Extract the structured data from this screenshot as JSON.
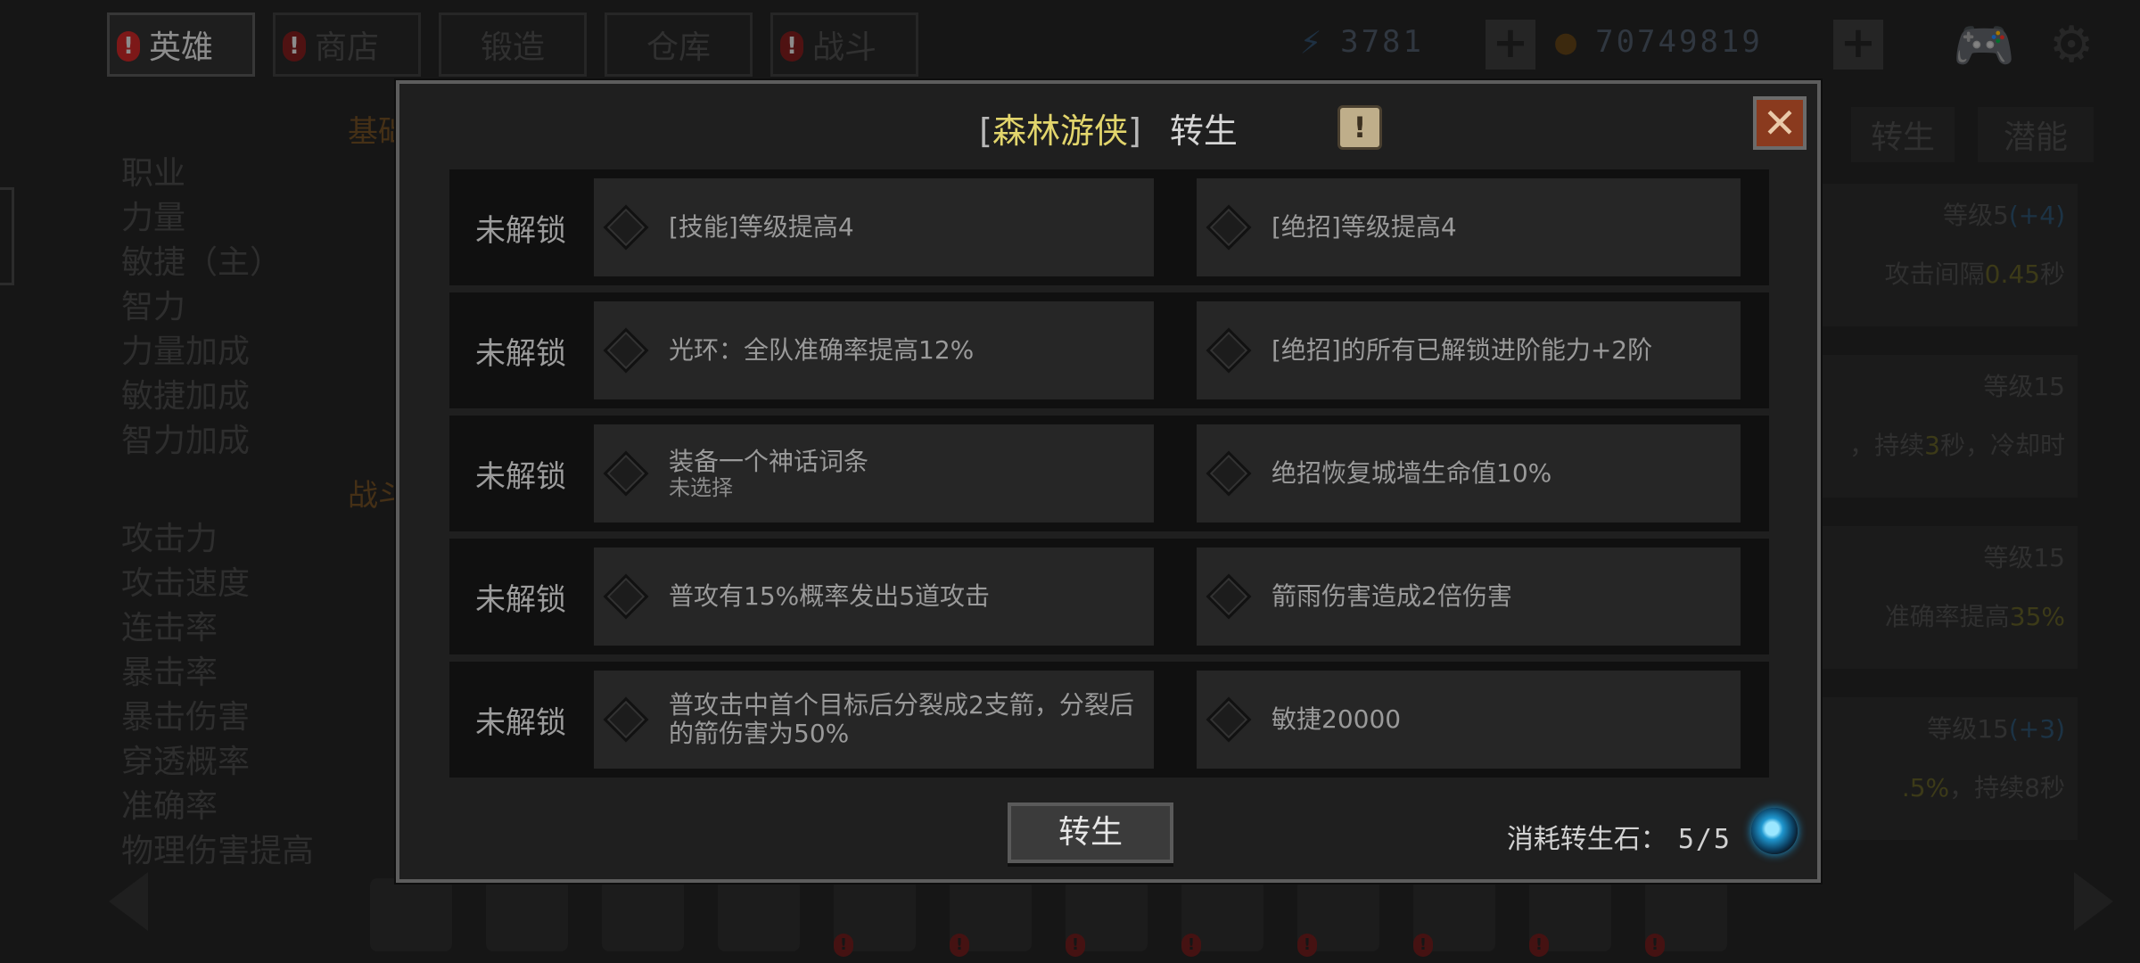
{
  "topnav": {
    "tabs": [
      {
        "label": "英雄",
        "alert": "!"
      },
      {
        "label": "商店",
        "alert": "!"
      },
      {
        "label": "锻造",
        "alert": ""
      },
      {
        "label": "仓库",
        "alert": ""
      },
      {
        "label": "战斗",
        "alert": "!"
      }
    ],
    "energy": "3781",
    "gold": "70749819",
    "energy_icon": "lightning-icon",
    "gold_icon": "coin-icon"
  },
  "background": {
    "section_basic": "基础",
    "section_battle": "战斗",
    "basic_stats": [
      "职业",
      "力量",
      "敏捷（主）",
      "智力",
      "力量加成",
      "敏捷加成",
      "智力加成"
    ],
    "battle_stats": [
      "攻击力",
      "攻击速度",
      "连击率",
      "暴击率",
      "暴击伤害",
      "穿透概率",
      "准确率",
      "物理伤害提高"
    ],
    "right_tabs": [
      "转生",
      "潜能"
    ],
    "cards": [
      {
        "level": "等级5",
        "bonus": "(+4)",
        "text_pre": "攻击间隔",
        "text_hl": "0.45",
        "text_post": "秒"
      },
      {
        "level": "等级15",
        "bonus": "",
        "text_pre": "，持续",
        "text_hl": "3",
        "text_post": "秒，冷却时"
      },
      {
        "level": "等级15",
        "bonus": "",
        "text_pre": "准确率提高",
        "text_hl": "35%",
        "text_post": ""
      },
      {
        "level": "等级15",
        "bonus": "(+3)",
        "text_pre": "",
        "text_hl": ".5%",
        "text_post": "，持续8秒"
      }
    ]
  },
  "modal": {
    "title_open": "[",
    "hero_name": "森林游侠",
    "title_close": "]",
    "title_suffix": "转生",
    "info_label": "!",
    "close_label": "✕",
    "rows": [
      {
        "status": "未解锁",
        "left": "[技能]等级提高4",
        "left_sub": "",
        "right": "[绝招]等级提高4"
      },
      {
        "status": "未解锁",
        "left": "光环：全队准确率提高12%",
        "left_sub": "",
        "right": "[绝招]的所有已解锁进阶能力+2阶"
      },
      {
        "status": "未解锁",
        "left": "装备一个神话词条",
        "left_sub": "未选择",
        "right": "绝招恢复城墙生命值10%"
      },
      {
        "status": "未解锁",
        "left": "普攻有15%概率发出5道攻击",
        "left_sub": "",
        "right": "箭雨伤害造成2倍伤害"
      },
      {
        "status": "未解锁",
        "left": "普攻击中首个目标后分裂成2支箭，分裂后的箭伤害为50%",
        "left_sub": "",
        "right": "敏捷20000"
      }
    ],
    "rebirth_button": "转生",
    "cost_label": "消耗转生石：",
    "cost_value": "5/5"
  }
}
